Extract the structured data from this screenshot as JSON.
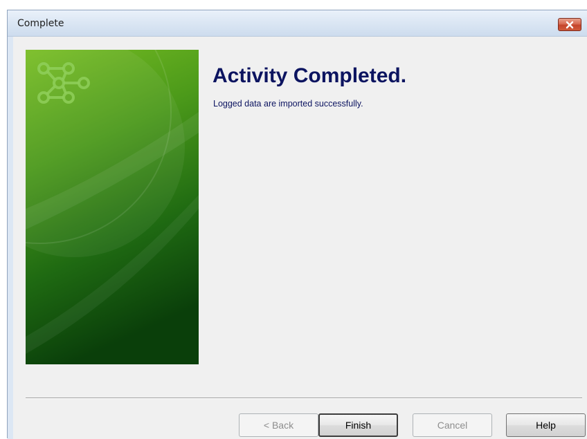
{
  "window": {
    "title": "Complete",
    "close_icon": "close-icon"
  },
  "banner": {
    "logo_icon": "connected-circles-logo-icon",
    "colors": {
      "light": "#6fb524",
      "dark": "#0c4a0c"
    }
  },
  "main": {
    "heading": "Activity Completed.",
    "message": "Logged data are imported successfully."
  },
  "footer": {
    "buttons": {
      "back": {
        "label": "< Back",
        "enabled": false
      },
      "finish": {
        "label": "Finish",
        "enabled": true,
        "default": true
      },
      "cancel": {
        "label": "Cancel",
        "enabled": false
      },
      "help": {
        "label": "Help",
        "enabled": true
      }
    }
  }
}
